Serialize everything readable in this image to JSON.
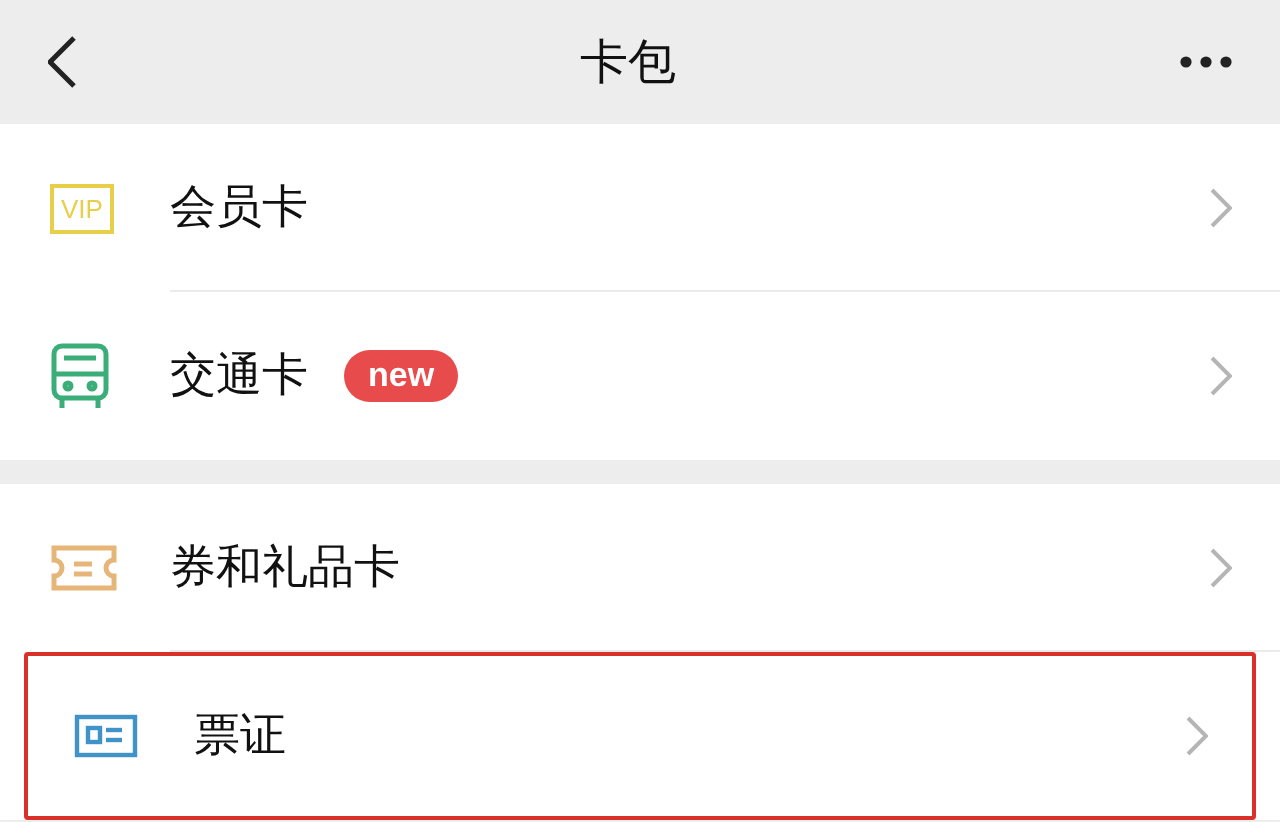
{
  "header": {
    "title": "卡包"
  },
  "sections": [
    {
      "items": [
        {
          "kind": "vip",
          "icon_text": "VIP",
          "label": "会员卡",
          "highlighted": false
        },
        {
          "kind": "bus",
          "label": "交通卡",
          "badge": "new",
          "highlighted": false
        }
      ]
    },
    {
      "items": [
        {
          "kind": "coupon",
          "label": "券和礼品卡",
          "highlighted": false
        },
        {
          "kind": "ticket",
          "label": "票证",
          "highlighted": true
        }
      ]
    }
  ]
}
